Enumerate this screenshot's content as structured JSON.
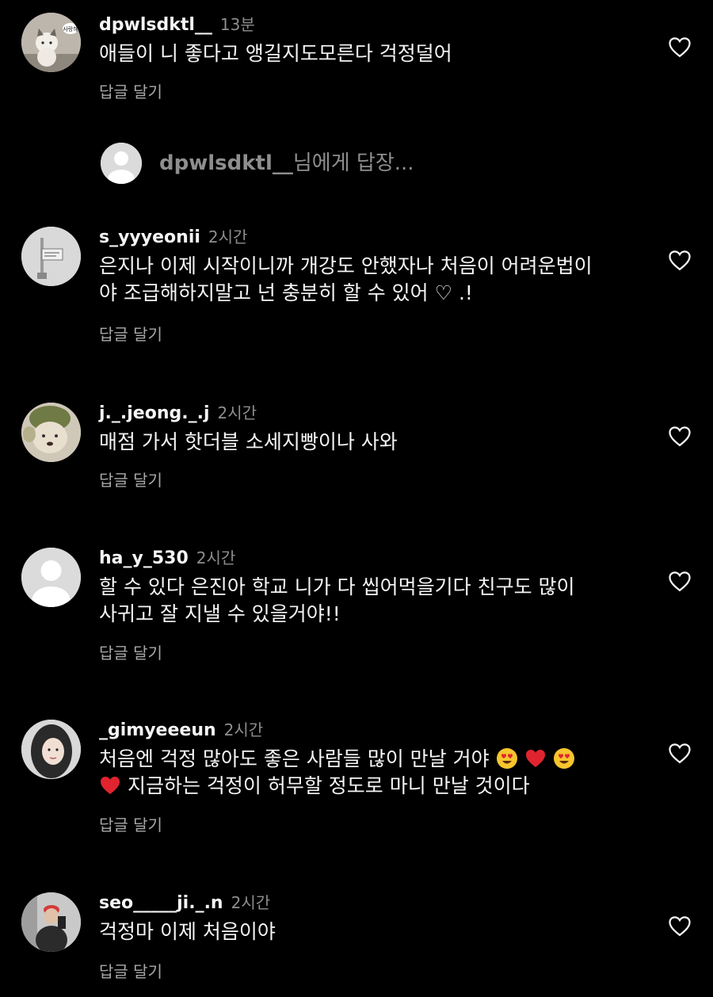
{
  "reply_bar": {
    "target_user": "dpwlsdktl__",
    "suffix": "님에게 답장..."
  },
  "reply_label": "답글 달기",
  "comments": [
    {
      "user": "dpwlsdktl__",
      "time": "13분",
      "lines": [
        "애들이 니 좋다고 앵길지도모른다 걱정덜어"
      ],
      "avatar_text": "사랑해"
    },
    {
      "user": "s_yyyeonii",
      "time": "2시간",
      "lines": [
        "은지나 이제 시작이니까 개강도 안했자나 처음이 어려운법이",
        "야 조급해하지말고 넌 충분히 할 수 있어 ♡ .!"
      ]
    },
    {
      "user": "j._.jeong._.j",
      "time": "2시간",
      "lines": [
        "매점 가서 핫더블 소세지빵이나 사와"
      ]
    },
    {
      "user": "ha_y_530",
      "time": "2시간",
      "lines": [
        "할 수 있다 은진아 학교 니가 다 씹어먹을기다 친구도 많이",
        "사귀고 잘 지낼 수 있을거야!!"
      ]
    },
    {
      "user": "_gimyeeeun",
      "time": "2시간",
      "lines": [
        "처음엔 걱정 많아도 좋은 사람들 많이 만날 거야",
        "지금하는 걱정이 허무할 정도로 마니 만날 것이다"
      ]
    },
    {
      "user": "seo_____ji._.n",
      "time": "2시간",
      "lines": [
        "걱정마 이제 처음이야"
      ]
    }
  ]
}
